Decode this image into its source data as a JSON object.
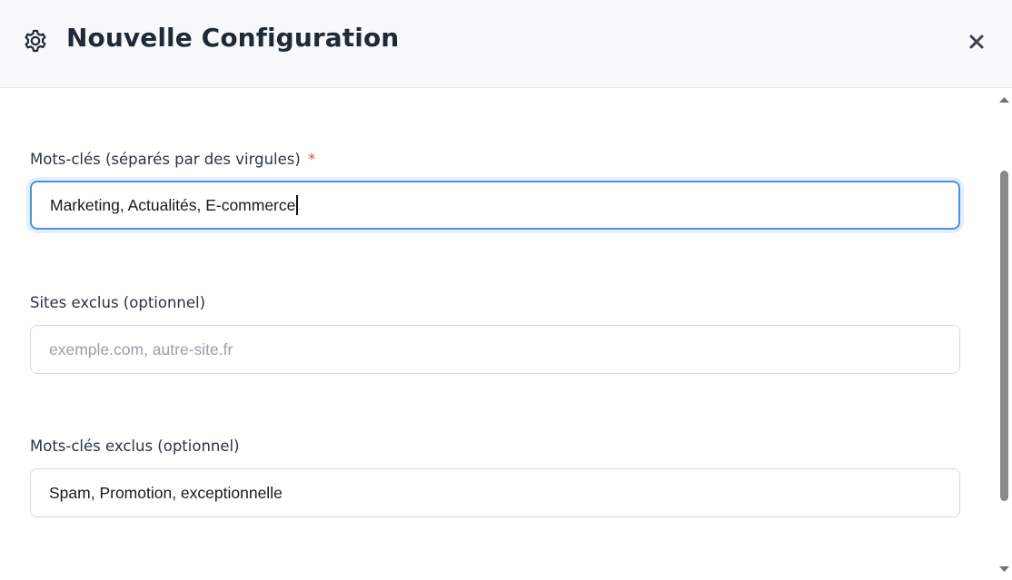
{
  "header": {
    "title": "Nouvelle Configuration",
    "icon": "gear-icon",
    "close_icon": "close-icon"
  },
  "form": {
    "keywords": {
      "label": "Mots-clés (séparés par des virgules)",
      "required_marker": "*",
      "value": "Marketing, Actualités, E-commerce"
    },
    "excluded_sites": {
      "label": "Sites exclus (optionnel)",
      "value": "",
      "placeholder": "exemple.com, autre-site.fr"
    },
    "excluded_keywords": {
      "label": "Mots-clés exclus (optionnel)",
      "value": "Spam, Promotion, exceptionnelle"
    }
  },
  "colors": {
    "focus_border": "#4a90e2",
    "required": "#e05252",
    "header_bg": "#f7f9fb"
  }
}
